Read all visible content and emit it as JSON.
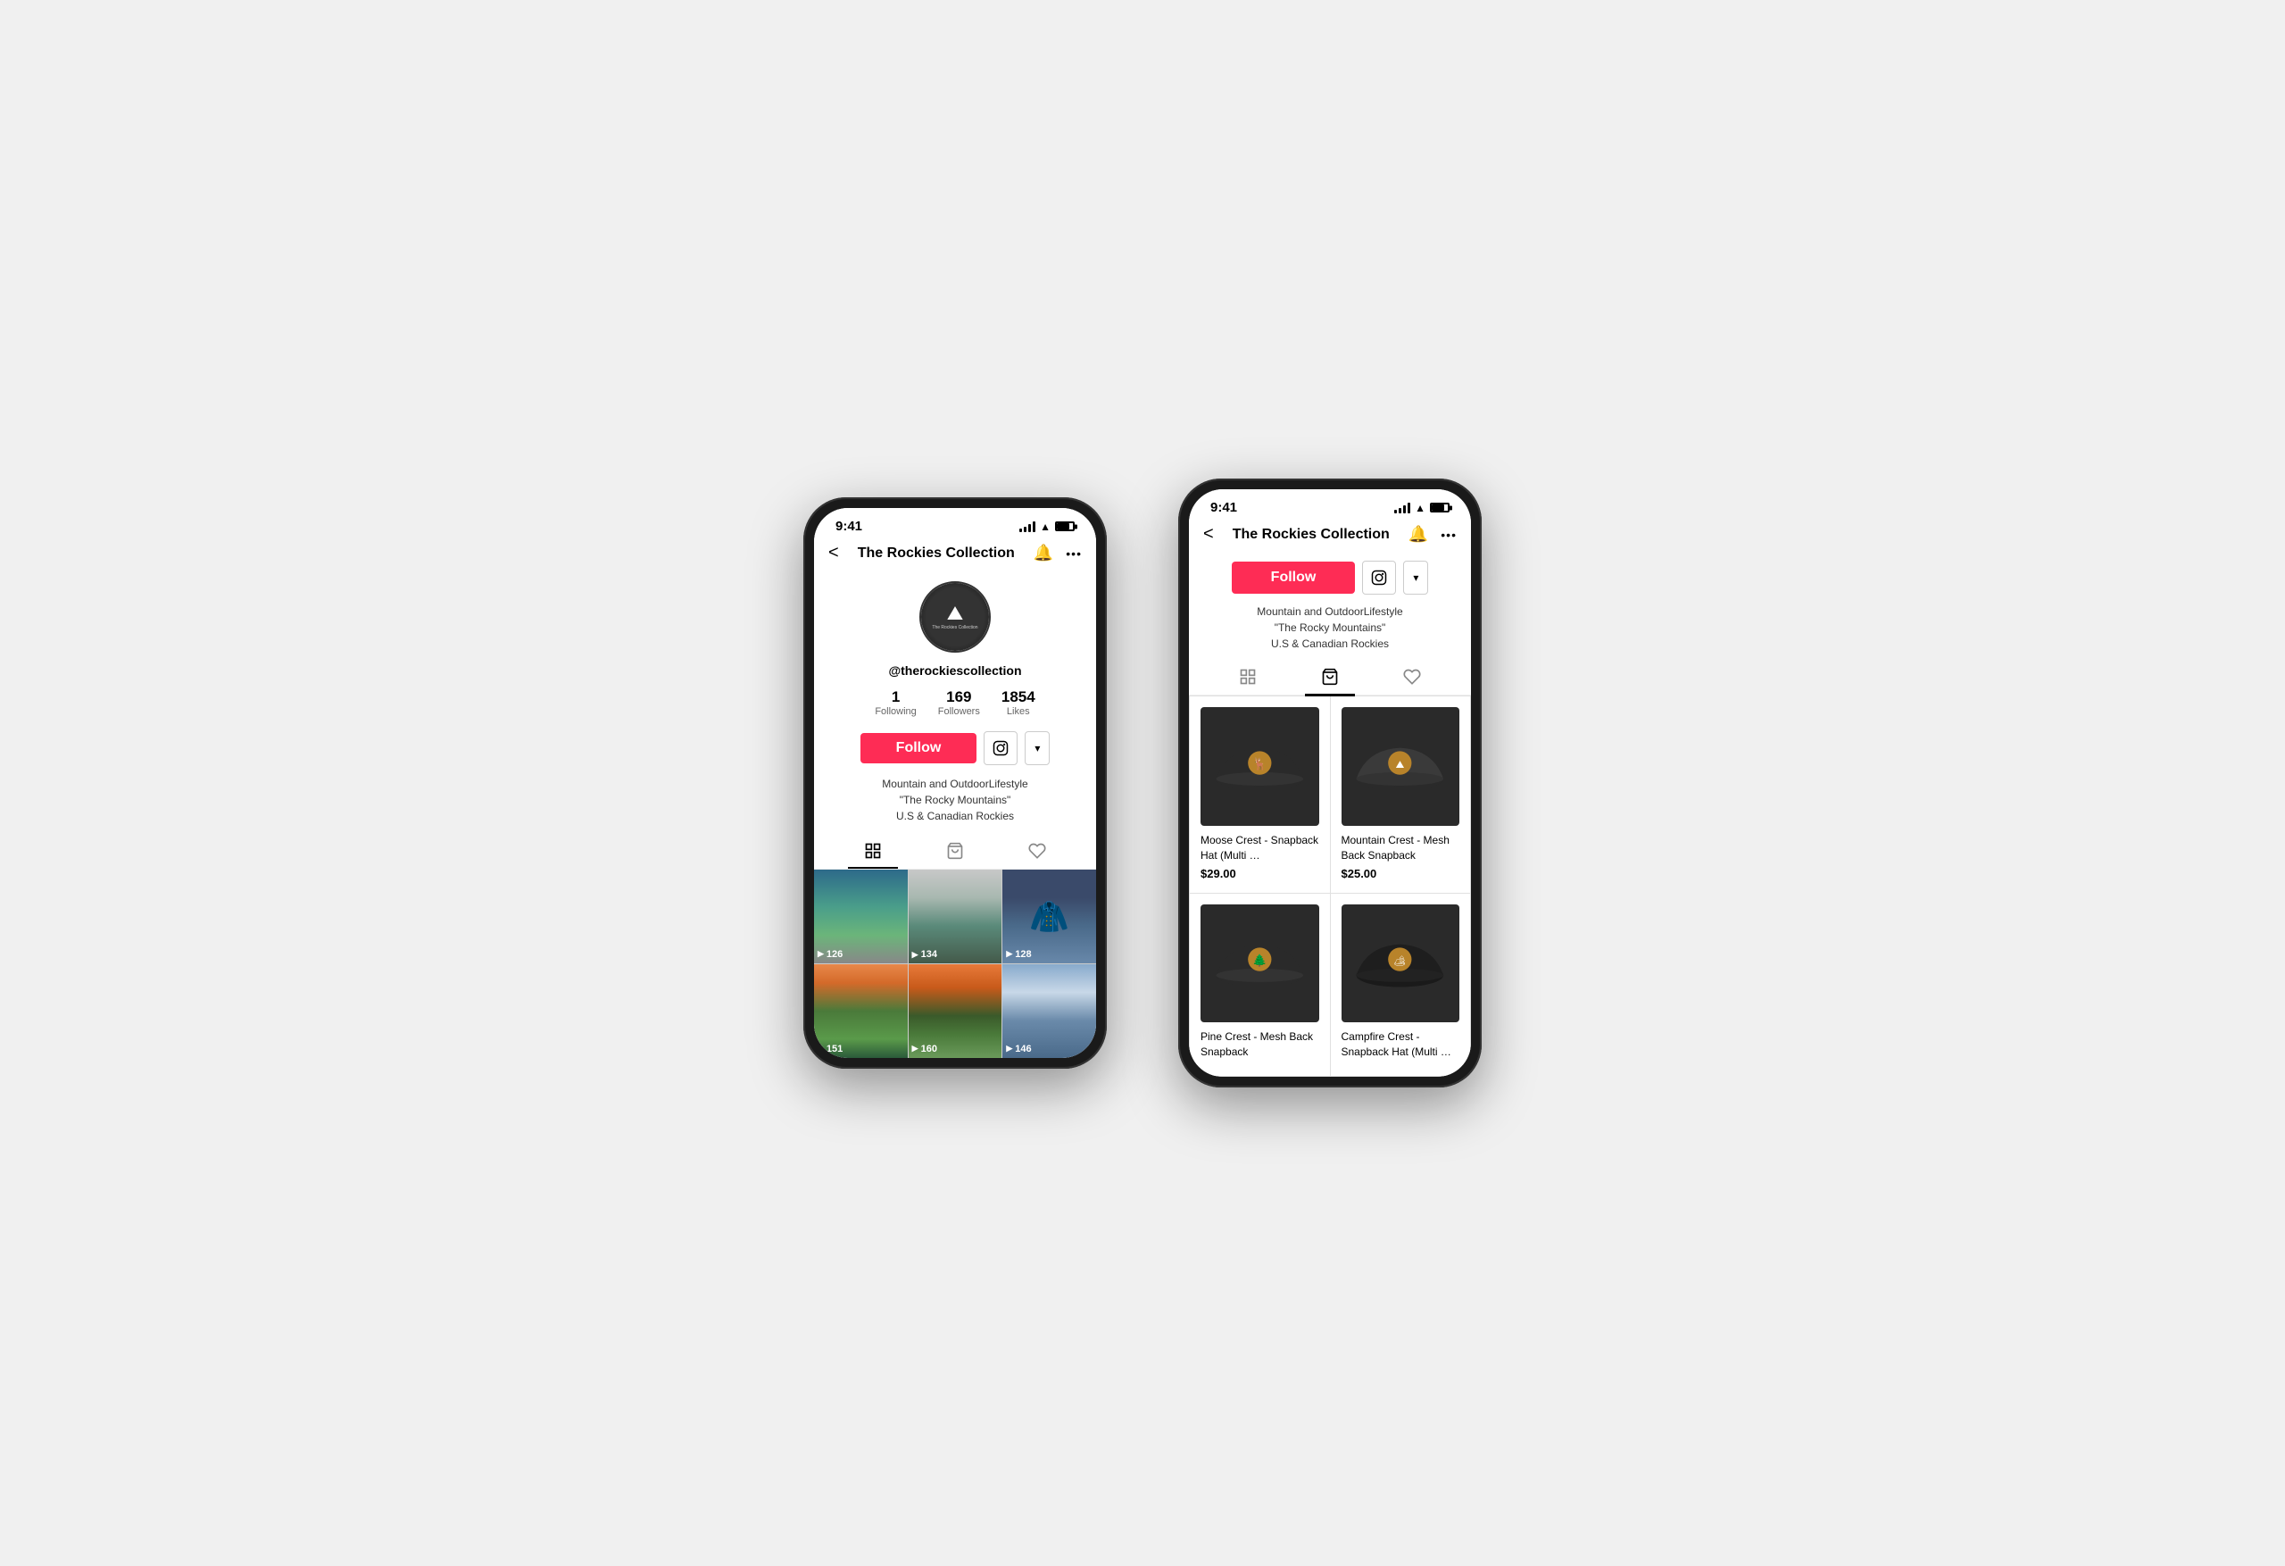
{
  "phones": {
    "left": {
      "status": {
        "time": "9:41",
        "signal": [
          2,
          3,
          4,
          5
        ],
        "wifi": true,
        "battery": true
      },
      "nav": {
        "title": "The Rockies Collection",
        "back_label": "<",
        "bell_label": "🔔",
        "more_label": "•••"
      },
      "profile": {
        "username": "@therockiescollection",
        "stats": [
          {
            "num": "1",
            "label": "Following"
          },
          {
            "num": "169",
            "label": "Followers"
          },
          {
            "num": "1854",
            "label": "Likes"
          }
        ],
        "follow_btn": "Follow",
        "bio_lines": [
          "Mountain and OutdoorLifestyle",
          "\"The Rocky Mountains\"",
          "U.S & Canadian Rockies"
        ]
      },
      "tabs": [
        {
          "icon": "⊞",
          "active": true
        },
        {
          "icon": "🛍",
          "active": false
        },
        {
          "icon": "♡",
          "active": false
        }
      ],
      "videos": [
        {
          "count": "126",
          "thumb_class": "thumb-1"
        },
        {
          "count": "134",
          "thumb_class": "thumb-2"
        },
        {
          "count": "128",
          "thumb_class": "thumb-3"
        },
        {
          "count": "151",
          "thumb_class": "thumb-4"
        },
        {
          "count": "160",
          "thumb_class": "thumb-5"
        },
        {
          "count": "146",
          "thumb_class": "thumb-6"
        }
      ]
    },
    "right": {
      "status": {
        "time": "9:41"
      },
      "nav": {
        "title": "The Rockies Collection",
        "back_label": "<",
        "bell_label": "🔔",
        "more_label": "•••"
      },
      "shop": {
        "follow_btn": "Follow",
        "bio_lines": [
          "Mountain and OutdoorLifestyle",
          "\"The Rocky Mountains\"",
          "U.S & Canadian Rockies"
        ]
      },
      "tabs": [
        {
          "icon": "⊞",
          "active": false
        },
        {
          "icon": "🛍",
          "active": true
        },
        {
          "icon": "♡",
          "active": false
        }
      ],
      "products": [
        {
          "name": "Moose Crest - Snapback Hat (Multi …",
          "price": "$29.00",
          "badge_color": "#b8832a",
          "badge_icon": "moose"
        },
        {
          "name": "Mountain Crest - Mesh Back Snapback",
          "price": "$25.00",
          "badge_color": "#b8832a",
          "badge_icon": "mountain"
        },
        {
          "name": "Pine Crest - Mesh Back Snapback",
          "price": "",
          "badge_color": "#b8832a",
          "badge_icon": "tree"
        },
        {
          "name": "Campfire Crest - Snapback Hat (Multi …",
          "price": "",
          "badge_color": "#b8832a",
          "badge_icon": "campfire"
        }
      ]
    }
  }
}
